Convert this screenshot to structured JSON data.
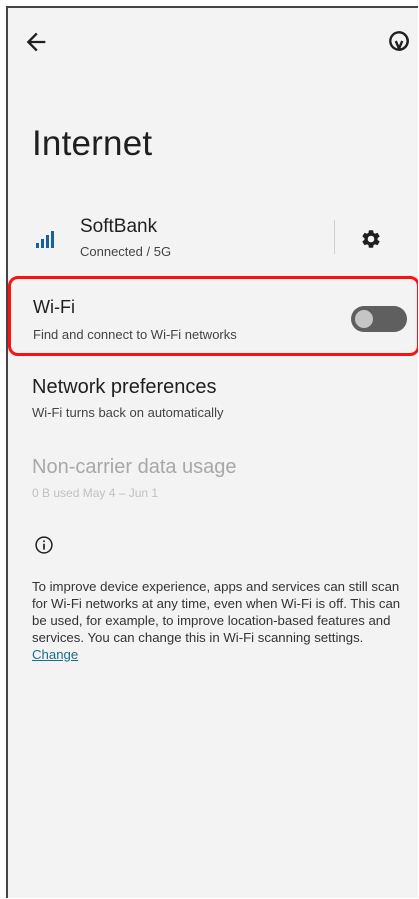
{
  "header": {
    "back_icon": "arrow-back-icon",
    "refresh_icon": "refresh-icon",
    "title": "Internet"
  },
  "carrier": {
    "name": "SoftBank",
    "status": "Connected / 5G",
    "signal_icon": "signal-bars-icon",
    "settings_icon": "gear-icon",
    "signal_color": "#1a5f9e"
  },
  "wifi": {
    "title": "Wi-Fi",
    "description": "Find and connect to Wi-Fi networks",
    "toggle_on": false,
    "highlight_color": "#ff1010"
  },
  "network_preferences": {
    "title": "Network preferences",
    "description": "Wi-Fi turns back on automatically"
  },
  "non_carrier_usage": {
    "title": "Non-carrier data usage",
    "description": "0 B used May 4 – Jun 1",
    "enabled": false
  },
  "info": {
    "icon": "info-icon",
    "text": "To improve device experience, apps and services can still scan for Wi-Fi networks at any time, even when Wi-Fi is off. This can be used, for example, to improve location-based features and services. You can change this in Wi-Fi scanning settings. ",
    "link_text": "Change",
    "link_color": "#1a6e8a"
  }
}
